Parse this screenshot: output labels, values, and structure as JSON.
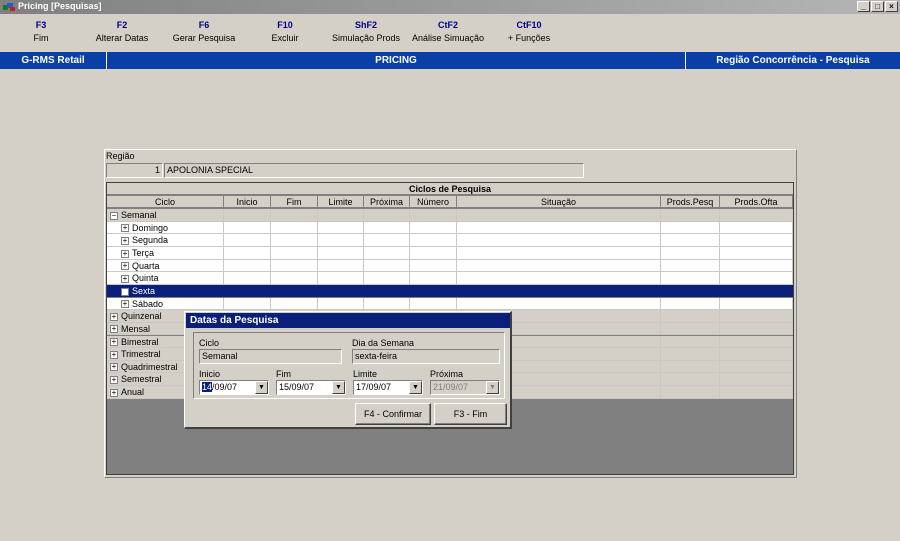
{
  "window": {
    "title": "Pricing [Pesquisas]",
    "icon": "pricing-app-icon",
    "controls": [
      "_",
      "□",
      "×"
    ]
  },
  "toolbar": [
    {
      "key": "F3",
      "label": "Fim"
    },
    {
      "key": "F2",
      "label": "Alterar Datas"
    },
    {
      "key": "F6",
      "label": "Gerar Pesquisa"
    },
    {
      "key": "F10",
      "label": "Excluir"
    },
    {
      "key": "ShF2",
      "label": "Simulação Prods"
    },
    {
      "key": "CtF2",
      "label": "Análise Simuação"
    },
    {
      "key": "CtF10",
      "label": "+ Funções"
    }
  ],
  "header": {
    "left": "G-RMS Retail",
    "center": "PRICING",
    "right": "Região Concorrência - Pesquisa"
  },
  "region": {
    "label": "Região",
    "code": "1",
    "name": "APOLONIA SPECIAL"
  },
  "grid": {
    "title": "Ciclos de Pesquisa",
    "columns": [
      "Ciclo",
      "Inicio",
      "Fim",
      "Limite",
      "Próxima",
      "Número",
      "Situação",
      "Prods.Pesq",
      "Prods.Ofta"
    ],
    "rows": [
      {
        "label": "Semanal",
        "level": 0,
        "expander": "−",
        "selected": false,
        "white": false
      },
      {
        "label": "Domingo",
        "level": 1,
        "expander": "+",
        "selected": false,
        "white": true
      },
      {
        "label": "Segunda",
        "level": 1,
        "expander": "+",
        "selected": false,
        "white": true
      },
      {
        "label": "Terça",
        "level": 1,
        "expander": "+",
        "selected": false,
        "white": true
      },
      {
        "label": "Quarta",
        "level": 1,
        "expander": "+",
        "selected": false,
        "white": true
      },
      {
        "label": "Quinta",
        "level": 1,
        "expander": "+",
        "selected": false,
        "white": true
      },
      {
        "label": "Sexta",
        "level": 1,
        "expander": "",
        "selected": true,
        "white": true
      },
      {
        "label": "Sábado",
        "level": 1,
        "expander": "+",
        "selected": false,
        "white": true
      },
      {
        "label": "Quinzenal",
        "level": 0,
        "expander": "+",
        "selected": false,
        "white": false
      },
      {
        "label": "Mensal",
        "level": 0,
        "expander": "+",
        "selected": false,
        "white": false
      },
      {
        "label": "Bimestral",
        "level": 0,
        "expander": "+",
        "selected": false,
        "white": false
      },
      {
        "label": "Trimestral",
        "level": 0,
        "expander": "+",
        "selected": false,
        "white": false
      },
      {
        "label": "Quadrimestral",
        "level": 0,
        "expander": "+",
        "selected": false,
        "white": false
      },
      {
        "label": "Semestral",
        "level": 0,
        "expander": "+",
        "selected": false,
        "white": false
      },
      {
        "label": "Anual",
        "level": 0,
        "expander": "+",
        "selected": false,
        "white": false
      }
    ]
  },
  "dialog": {
    "title": "Datas da Pesquisa",
    "ciclo_label": "Ciclo",
    "ciclo_value": "Semanal",
    "dia_label": "Dia da Semana",
    "dia_value": "sexta-feira",
    "inicio_label": "Inicio",
    "inicio_sel": "14",
    "inicio_rest": "/09/07",
    "fim_label": "Fim",
    "fim_value": "15/09/07",
    "limite_label": "Limite",
    "limite_value": "17/09/07",
    "proxima_label": "Próxima",
    "proxima_value": "21/09/07",
    "confirm_label": "F4 - Confirmar",
    "end_label": "F3 - Fim"
  },
  "colors": {
    "header_blue": "#0a3fa8",
    "selection": "#0a1f7a",
    "face": "#d4d0c8",
    "dark_gray": "#808080"
  }
}
